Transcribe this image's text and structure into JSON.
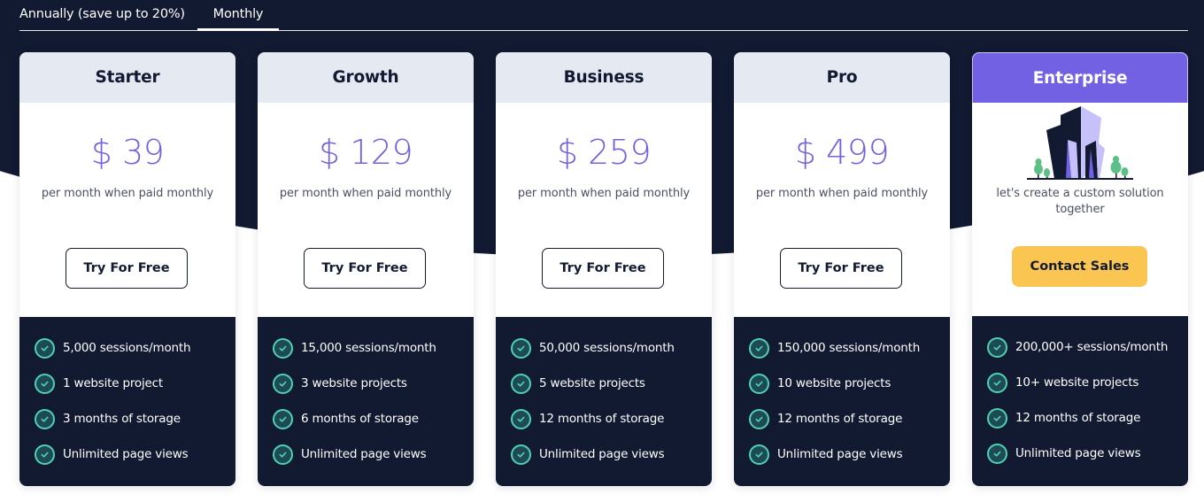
{
  "billing_toggle": {
    "options": [
      {
        "label": "Annually (save up to 20%)",
        "active": false
      },
      {
        "label": "Monthly",
        "active": true
      }
    ]
  },
  "colors": {
    "accent": "#7262e3",
    "dark": "#111a31",
    "header_light": "#e5e9f2",
    "cta_yellow": "#fbc552",
    "check_green": "#4fd1b5"
  },
  "plans": [
    {
      "name": "Starter",
      "price": "$ 39",
      "period": "per month when paid monthly",
      "button": "Try For Free",
      "features": [
        "5,000 sessions/month",
        "1 website project",
        "3 months of storage",
        "Unlimited page views"
      ]
    },
    {
      "name": "Growth",
      "price": "$ 129",
      "period": "per month when paid monthly",
      "button": "Try For Free",
      "features": [
        "15,000 sessions/month",
        "3 website projects",
        "6 months of storage",
        "Unlimited page views"
      ]
    },
    {
      "name": "Business",
      "price": "$ 259",
      "period": "per month when paid monthly",
      "button": "Try For Free",
      "features": [
        "50,000 sessions/month",
        "5 website projects",
        "12 months of storage",
        "Unlimited page views"
      ]
    },
    {
      "name": "Pro",
      "price": "$ 499",
      "period": "per month when paid monthly",
      "button": "Try For Free",
      "features": [
        "150,000 sessions/month",
        "10 website projects",
        "12 months of storage",
        "Unlimited page views"
      ]
    },
    {
      "name": "Enterprise",
      "illustration": "buildings-icon",
      "description": "let's create a custom solution together",
      "button": "Contact Sales",
      "features": [
        "200,000+ sessions/month",
        "10+ website projects",
        "12 months of storage",
        "Unlimited page views"
      ]
    }
  ]
}
